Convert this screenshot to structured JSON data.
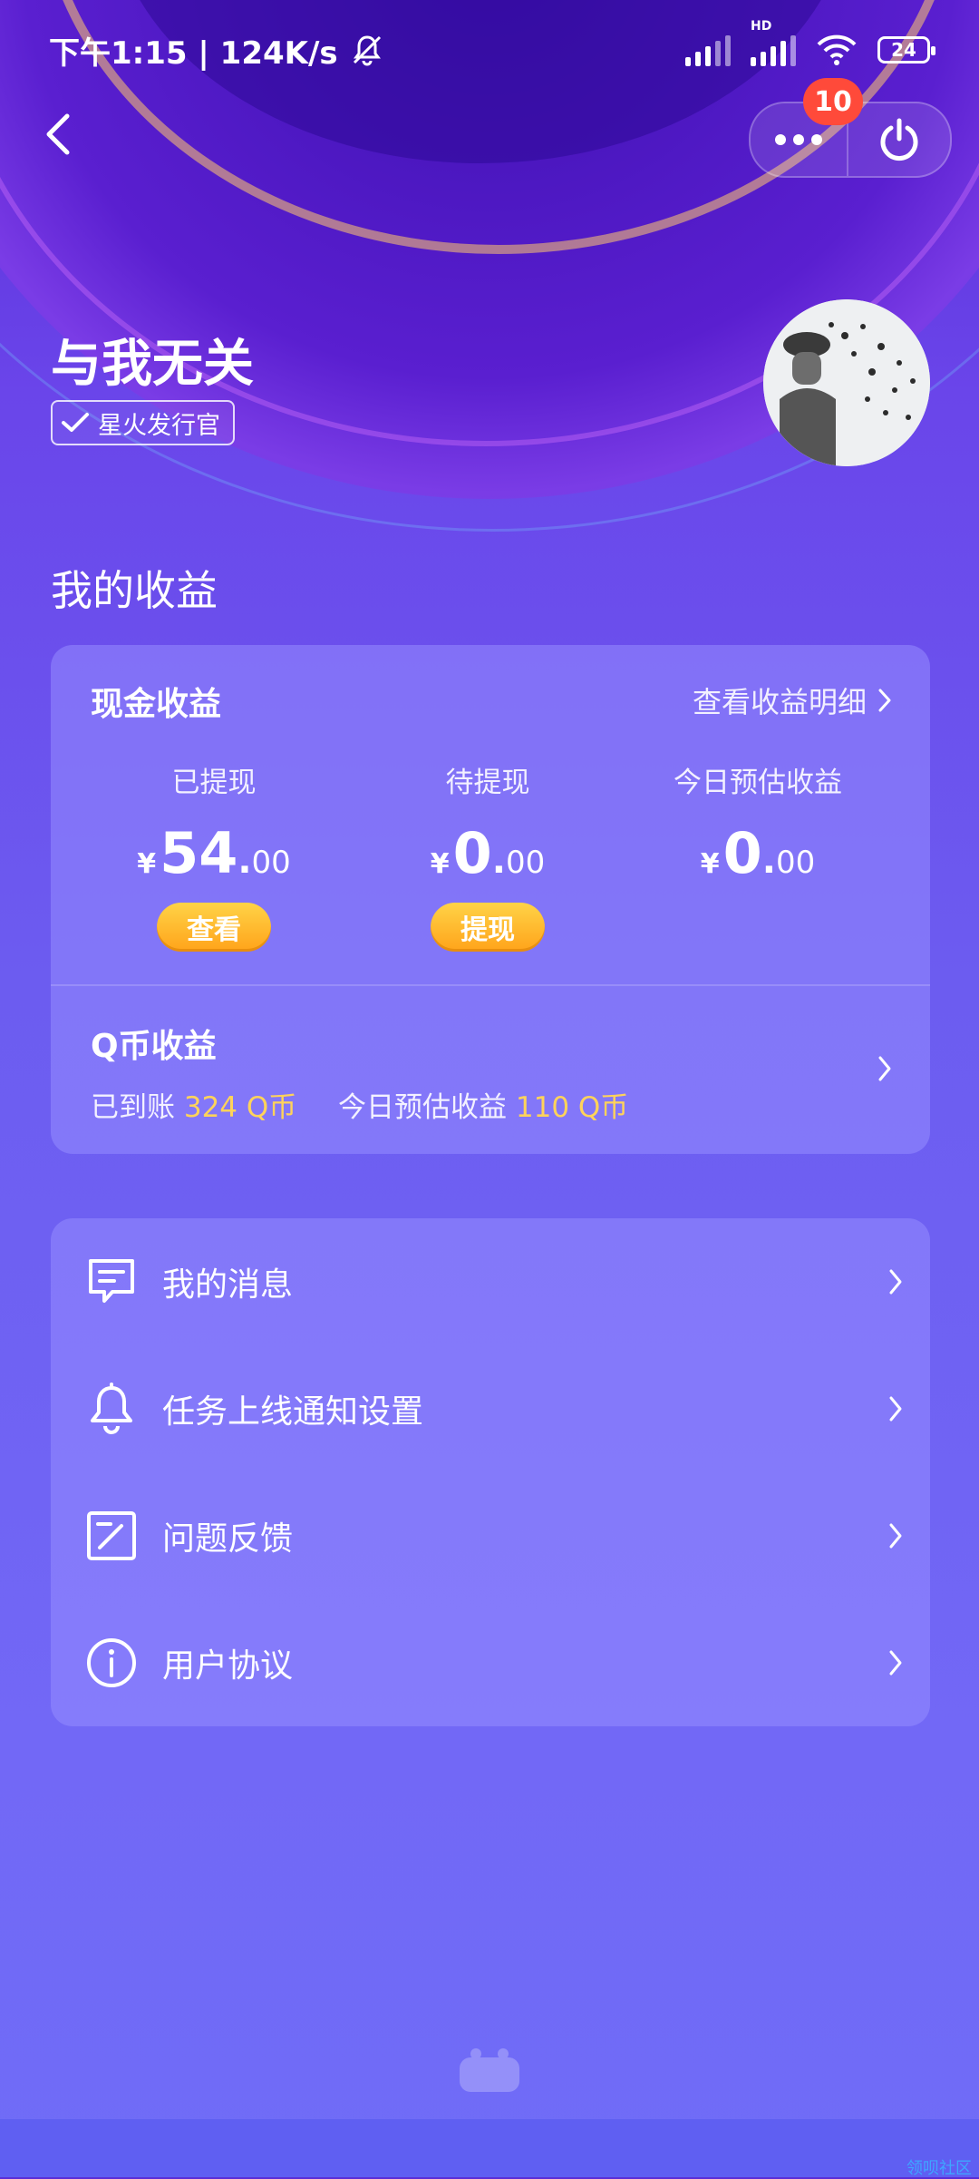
{
  "status_bar": {
    "time_speed": "下午1:15 | 124K/s",
    "hd": "HD",
    "battery": "24"
  },
  "header": {
    "notification_count": "10"
  },
  "profile": {
    "username": "与我无关",
    "tag_label": "星火发行官"
  },
  "earnings": {
    "section_title": "我的收益",
    "cash": {
      "title": "现金收益",
      "detail_link": "查看收益明细",
      "currency": "¥",
      "withdrawn": {
        "label": "已提现",
        "int": "54",
        "dec": "00",
        "button": "查看"
      },
      "pending": {
        "label": "待提现",
        "int": "0",
        "dec": "00",
        "button": "提现"
      },
      "today": {
        "label": "今日预估收益",
        "int": "0",
        "dec": "00"
      }
    },
    "qcoin": {
      "title": "Q币收益",
      "received_label": "已到账",
      "received_value": "324 Q币",
      "today_label": "今日预估收益",
      "today_value": "110 Q币"
    }
  },
  "menu": [
    {
      "label": "我的消息",
      "icon": "message-icon"
    },
    {
      "label": "任务上线通知设置",
      "icon": "bell-icon"
    },
    {
      "label": "问题反馈",
      "icon": "feedback-edit-icon"
    },
    {
      "label": "用户协议",
      "icon": "info-icon"
    }
  ],
  "watermark": "领呗社区",
  "colors": {
    "accent_yellow": "#ffd35a",
    "badge_red": "#ff4a3a",
    "button_gradient_top": "#ffd347",
    "button_gradient_bottom": "#ffa31a"
  }
}
